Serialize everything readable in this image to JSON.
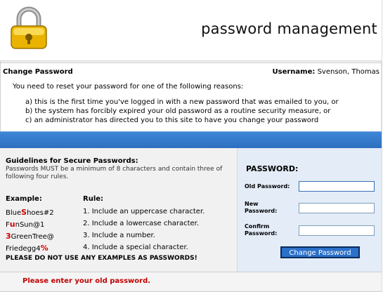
{
  "header": {
    "title": "password management",
    "logo_icon": "padlock-icon"
  },
  "section": {
    "title": "Change Password",
    "username_label": "Username:",
    "username_value": "Svenson, Thomas"
  },
  "reasons": {
    "intro": "You need to reset your password for one of the following reasons:",
    "items": [
      "a) this is the first time you've logged in with a new password that was emailed to you, or",
      "b) the system has forcibly expired your old password as a routine security measure, or",
      "c) an administrator has directed you to this site to have you change your password"
    ]
  },
  "guidelines": {
    "title": "Guidelines for Secure Passwords:",
    "description": "Passwords MUST be a minimum of 8 characters and contain three of following four rules.",
    "example_header": "Example:",
    "rule_header": "Rule:",
    "examples": [
      {
        "pre": "Blue",
        "hl": "S",
        "post": "hoes#2"
      },
      {
        "pre": "F",
        "hl": "u",
        "post": "nSun@1"
      },
      {
        "pre": "",
        "hl": "3",
        "post": "GreenTree@"
      },
      {
        "pre": "Friedegg4",
        "hl": "%",
        "post": ""
      }
    ],
    "rules": [
      "1. Include an uppercase character.",
      "2. Include a lowercase character.",
      "3. Include a number.",
      "4. Include a special character."
    ],
    "warning": "PLEASE DO NOT USE ANY EXAMPLES AS PASSWORDS!"
  },
  "form": {
    "title": "PASSWORD:",
    "old_label": "Old Password:",
    "new_label": "New Password:",
    "confirm_label": "Confirm Password:",
    "old_value": "",
    "new_value": "",
    "confirm_value": "",
    "submit_label": "Change Password"
  },
  "error": {
    "message": "Please enter your old password."
  },
  "colors": {
    "accent": "#2b70c9",
    "error": "#c00000",
    "highlight": "#d40000"
  }
}
